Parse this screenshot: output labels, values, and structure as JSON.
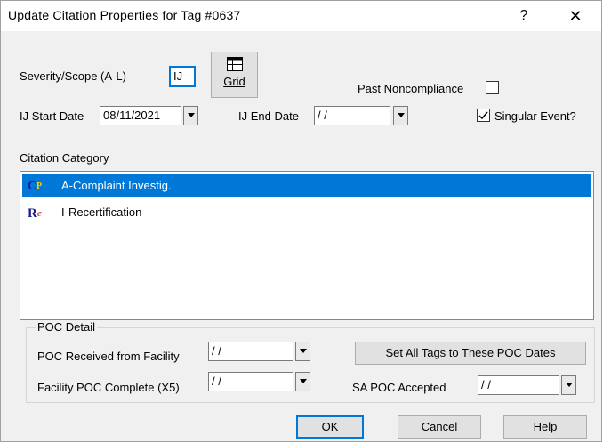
{
  "window": {
    "title": "Update Citation Properties for Tag #0637",
    "help_glyph": "?",
    "close_glyph": "✕"
  },
  "severity": {
    "label": "Severity/Scope (A-L)",
    "value": "IJ"
  },
  "grid_button": {
    "label": "Grid",
    "icon": "grid-icon"
  },
  "past_noncompliance": {
    "label": "Past Noncompliance",
    "checked": false
  },
  "ij_start": {
    "label": "IJ Start Date",
    "value": "08/11/2021"
  },
  "ij_end": {
    "label": "IJ End Date",
    "value": "/ /"
  },
  "singular_event": {
    "label": "Singular Event?",
    "checked": true
  },
  "citation_category": {
    "label": "Citation Category",
    "items": [
      {
        "icon": "complaint-icon",
        "label": "A-Complaint Investig.",
        "selected": true
      },
      {
        "icon": "recertification-icon",
        "label": "I-Recertification",
        "selected": false
      }
    ]
  },
  "poc": {
    "group_label": "POC Detail",
    "received_label": "POC Received from Facility",
    "received_value": "/ /",
    "complete_label": "Facility POC Complete (X5)",
    "complete_value": "/ /",
    "set_all_label": "Set All Tags to These POC Dates",
    "sa_label": "SA POC Accepted",
    "sa_value": "/ /"
  },
  "footer": {
    "ok": "OK",
    "cancel": "Cancel",
    "help": "Help"
  },
  "colors": {
    "selection": "#0078d7",
    "dialog_bg": "#f0f0f0"
  }
}
